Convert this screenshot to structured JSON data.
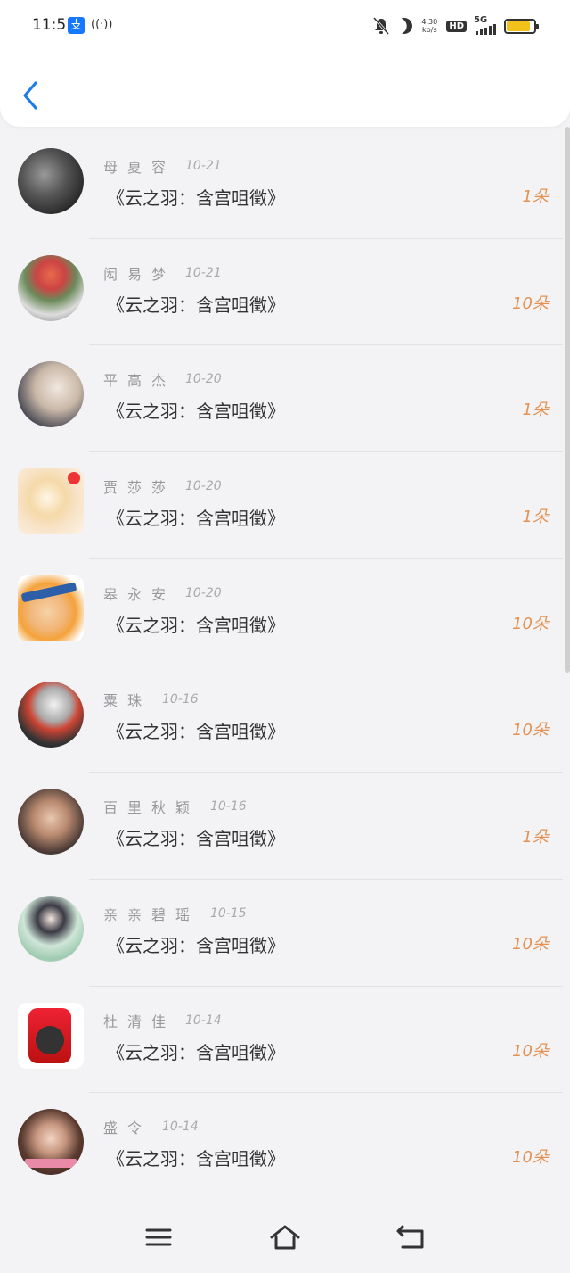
{
  "status_bar": {
    "time": "11:51",
    "pay_glyph": "支",
    "speed_value": "4.30",
    "speed_unit": "kb/s",
    "hd": "HD",
    "net": "5G"
  },
  "header": {
    "back_icon": "chevron-left-icon"
  },
  "colors": {
    "accent": "#1e7be8",
    "count": "#e49151",
    "name": "#999999"
  },
  "list": [
    {
      "name": "母夏容",
      "date": "10-21",
      "title": "《云之羽：含宫咀徵》",
      "count": "1朵"
    },
    {
      "name": "闳易梦",
      "date": "10-21",
      "title": "《云之羽：含宫咀徵》",
      "count": "10朵"
    },
    {
      "name": "平高杰",
      "date": "10-20",
      "title": "《云之羽：含宫咀徵》",
      "count": "1朵"
    },
    {
      "name": "贾莎莎",
      "date": "10-20",
      "title": "《云之羽：含宫咀徵》",
      "count": "1朵"
    },
    {
      "name": "皋永安",
      "date": "10-20",
      "title": "《云之羽：含宫咀徵》",
      "count": "10朵"
    },
    {
      "name": "粟珠",
      "date": "10-16",
      "title": "《云之羽：含宫咀徵》",
      "count": "10朵"
    },
    {
      "name": "百里秋颖",
      "date": "10-16",
      "title": "《云之羽：含宫咀徵》",
      "count": "1朵"
    },
    {
      "name": "亲亲碧瑶",
      "date": "10-15",
      "title": "《云之羽：含宫咀徵》",
      "count": "10朵"
    },
    {
      "name": "杜清佳",
      "date": "10-14",
      "title": "《云之羽：含宫咀徵》",
      "count": "10朵"
    },
    {
      "name": "盛令",
      "date": "10-14",
      "title": "《云之羽：含宫咀徵》",
      "count": "10朵"
    }
  ]
}
